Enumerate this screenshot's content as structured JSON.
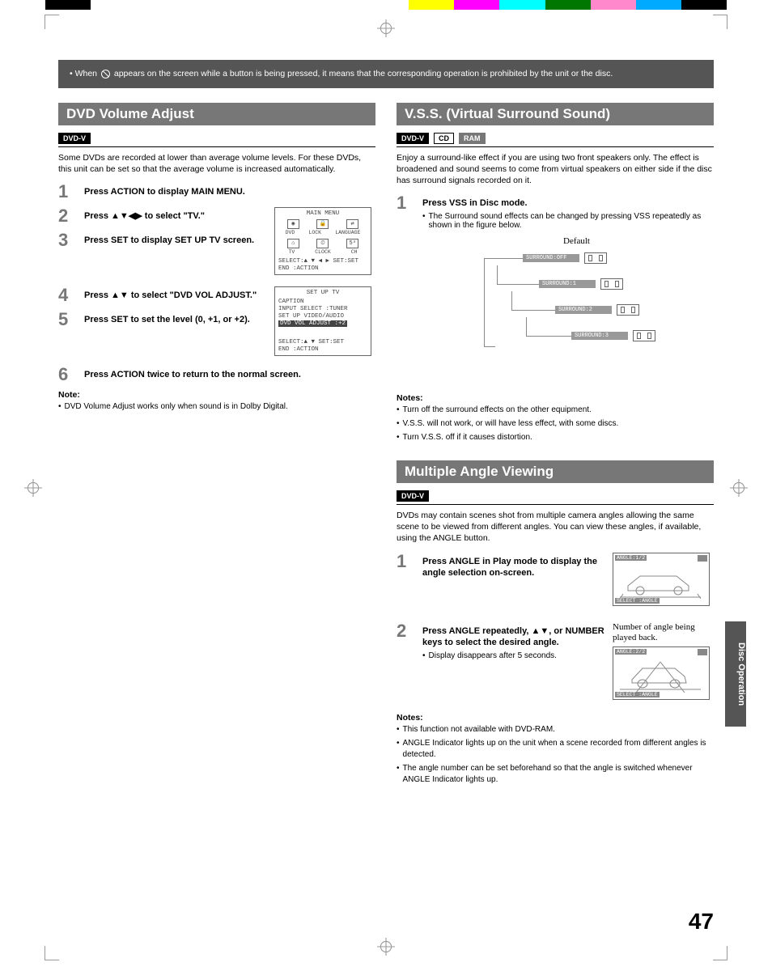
{
  "topNote": {
    "prefix": "• When",
    "suffix": "appears on the screen while a button is being pressed, it means that the corresponding operation is prohibited by the unit or the disc."
  },
  "sideTab": "Disc Operation",
  "pageNumber": "47",
  "left": {
    "title": "DVD Volume Adjust",
    "badges": [
      "DVD-V"
    ],
    "intro": "Some DVDs are recorded at lower than average volume levels. For these DVDs, this unit can be set so that the average volume is increased automatically.",
    "steps": [
      {
        "n": "1",
        "title": "Press ACTION to display MAIN MENU."
      },
      {
        "n": "2",
        "title": "Press ▲▼◀▶ to select \"TV.\""
      },
      {
        "n": "3",
        "title": "Press SET to display SET UP TV screen."
      },
      {
        "n": "4",
        "title": "Press ▲▼ to select \"DVD VOL ADJUST.\""
      },
      {
        "n": "5",
        "title": "Press SET to set the level (0, +1, or +2)."
      },
      {
        "n": "6",
        "title": "Press ACTION twice to return to the normal screen."
      }
    ],
    "osd1": {
      "title": "MAIN MENU",
      "row1": [
        "DVD",
        "LOCK",
        "LANGUAGE"
      ],
      "row2": [
        "TV",
        "CLOCK",
        "CH"
      ],
      "footer1": "SELECT:▲ ▼ ◀ ▶   SET:SET",
      "footer2": "END    :ACTION"
    },
    "osd2": {
      "title": "SET UP TV",
      "lines": [
        "CAPTION",
        "INPUT SELECT   :TUNER",
        "SET UP VIDEO/AUDIO"
      ],
      "highlight": "DVD VOL ADJUST :+2",
      "footer1": "SELECT:▲ ▼       SET:SET",
      "footer2": "END    :ACTION"
    },
    "noteH": "Note:",
    "notes": [
      "DVD Volume Adjust works only when sound is in Dolby Digital."
    ]
  },
  "rightTop": {
    "title": "V.S.S. (Virtual Surround Sound)",
    "badges": [
      "DVD-V",
      "CD",
      "RAM"
    ],
    "intro": "Enjoy a surround-like effect if you are using two front speakers only. The effect is broadened and sound seems to come from virtual speakers on either side if the disc has surround signals recorded on it.",
    "steps": [
      {
        "n": "1",
        "title": "Press VSS in Disc mode.",
        "sub": "The Surround sound effects can be changed by pressing VSS repeatedly as shown in the figure below."
      }
    ],
    "defaultLabel": "Default",
    "vssStates": [
      "SURROUND:OFF",
      "SURROUND:1",
      "SURROUND:2",
      "SURROUND:3"
    ],
    "noteH": "Notes:",
    "notes": [
      "Turn off the surround effects on the other equipment.",
      "V.S.S. will not work, or will have less effect, with some discs.",
      "Turn V.S.S. off if it causes distortion."
    ]
  },
  "rightBot": {
    "title": "Multiple Angle Viewing",
    "badges": [
      "DVD-V"
    ],
    "intro": "DVDs may contain scenes shot from multiple camera angles allowing the same scene to be viewed from different angles. You can view these angles, if available, using the ANGLE button.",
    "steps": [
      {
        "n": "1",
        "title": "Press ANGLE in Play mode to display the angle selection on-screen."
      },
      {
        "n": "2",
        "title": "Press ANGLE repeatedly, ▲▼, or NUMBER keys to select the desired angle.",
        "sub": "Display disappears after 5 seconds."
      }
    ],
    "fig1": {
      "top": "ANGLE:1/2",
      "bot": "SELECT :ANGLE"
    },
    "fig2note": "Number of angle being played back.",
    "fig2": {
      "top": "ANGLE:2/2",
      "bot": "SELECT :ANGLE"
    },
    "noteH": "Notes:",
    "notes": [
      "This function not available with DVD-RAM.",
      "ANGLE Indicator lights up on the unit when a scene recorded from different angles is detected.",
      "The angle number can be set beforehand so that the angle is switched whenever ANGLE Indicator lights up."
    ]
  }
}
